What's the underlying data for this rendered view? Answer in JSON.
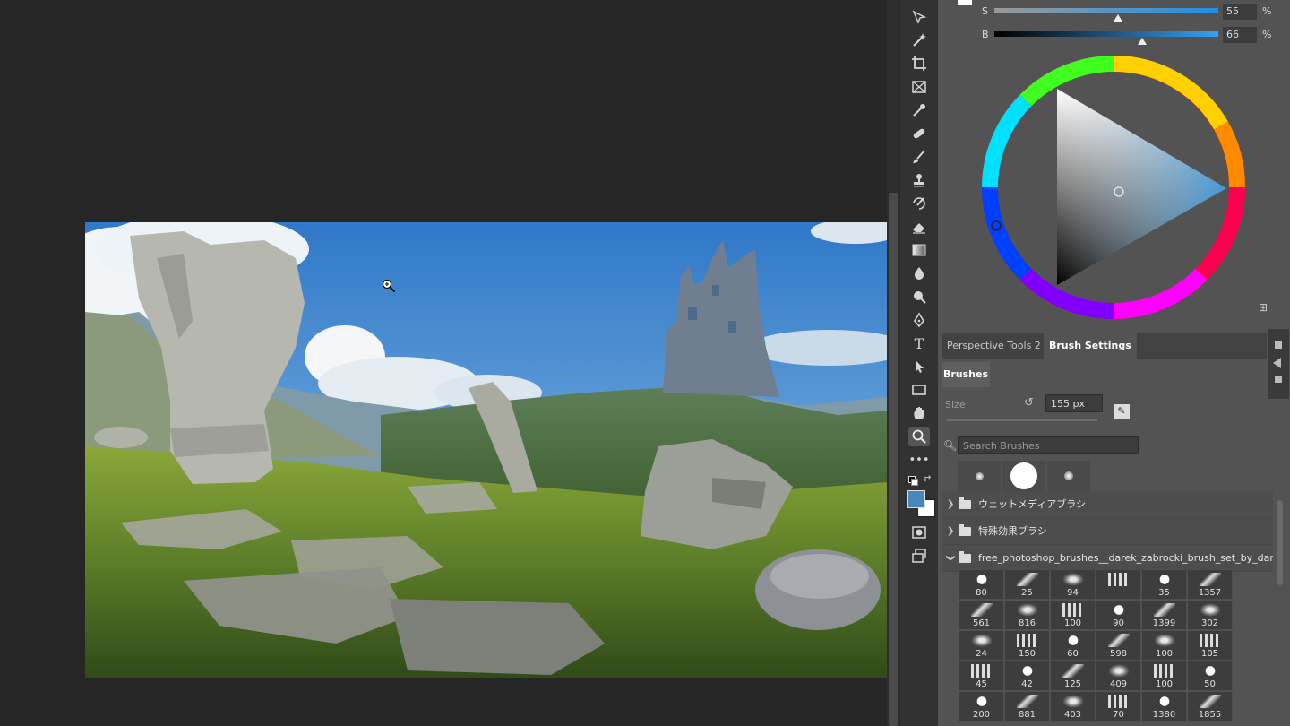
{
  "color_panel": {
    "sliders": [
      {
        "letter": "S",
        "value": "55",
        "unit": "%",
        "level": 0.55
      },
      {
        "letter": "B",
        "value": "66",
        "unit": "%",
        "level": 0.66
      }
    ]
  },
  "toolbar": {
    "tools": [
      "move-icon",
      "magic-wand-icon",
      "crop-icon",
      "frame-icon",
      "eyedropper-icon",
      "healing-brush-icon",
      "brush-icon",
      "clone-stamp-icon",
      "history-brush-icon",
      "eraser-icon",
      "gradient-icon",
      "blur-icon",
      "dodge-icon",
      "pen-icon",
      "type-icon",
      "path-selection-icon",
      "rectangle-icon",
      "hand-icon",
      "zoom-icon",
      "more-tools-icon"
    ],
    "active_tool": "zoom-icon",
    "foreground_color": "#4a86b8",
    "background_color": "#ffffff"
  },
  "panel_tabs": [
    "Perspective Tools 2",
    "Brush Settings"
  ],
  "brush_panel": {
    "tab": "Brushes",
    "size_label": "Size:",
    "size_value": "155 px",
    "search_placeholder": "Search Brushes",
    "groups": [
      {
        "name": "ウェットメディアブラシ",
        "expanded": false
      },
      {
        "name": "特殊効果ブラシ",
        "expanded": false
      },
      {
        "name": "free_photoshop_brushes__darek_zabrocki_brush_set_by_darek...",
        "expanded": true
      }
    ],
    "brush_sizes": [
      [
        "80",
        "25",
        "94",
        "",
        "35",
        "1357"
      ],
      [
        "561",
        "816",
        "100",
        "90",
        "1399",
        "302"
      ],
      [
        "24",
        "150",
        "60",
        "598",
        "100",
        "105"
      ],
      [
        "45",
        "42",
        "125",
        "409",
        "100",
        "50"
      ],
      [
        "200",
        "881",
        "403",
        "70",
        "1380",
        "1855"
      ]
    ]
  },
  "colors": {
    "canvas_bg": "#262626",
    "panel_bg": "#535353",
    "toolbar_bg": "#323232",
    "accent": "#3a9ee8"
  }
}
